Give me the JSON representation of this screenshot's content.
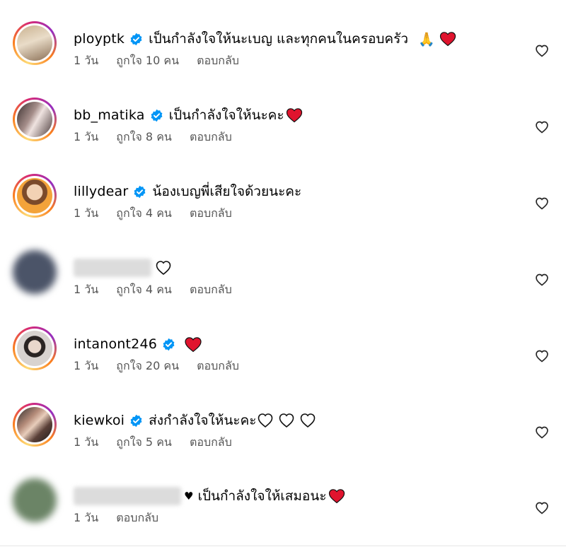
{
  "comments": [
    {
      "username": "ployptk",
      "verified": true,
      "text": "เป็นกำลังใจให้นะเบญ และทุกคนในครอบครัว",
      "emoji": "🙏",
      "time": "1 วัน",
      "likes": "ถูกใจ 10 คน",
      "reply": "ตอบกลับ"
    },
    {
      "username": "bb_matika",
      "verified": true,
      "text": "เป็นกำลังใจให้นะคะ",
      "time": "1 วัน",
      "likes": "ถูกใจ 8 คน",
      "reply": "ตอบกลับ"
    },
    {
      "username": "lillydear",
      "verified": true,
      "text": "น้องเบญพี่เสียใจด้วยนะคะ",
      "time": "1 วัน",
      "likes": "ถูกใจ 4 คน",
      "reply": "ตอบกลับ"
    },
    {
      "username": "",
      "verified": false,
      "text": "",
      "time": "1 วัน",
      "likes": "ถูกใจ 4 คน",
      "reply": "ตอบกลับ"
    },
    {
      "username": "intanont246",
      "verified": true,
      "text": "",
      "time": "1 วัน",
      "likes": "ถูกใจ 20 คน",
      "reply": "ตอบกลับ"
    },
    {
      "username": "kiewkoi",
      "verified": true,
      "text": "ส่งกำลังใจให้นะคะ",
      "time": "1 วัน",
      "likes": "ถูกใจ 5 คน",
      "reply": "ตอบกลับ"
    },
    {
      "username": "",
      "verified": false,
      "text": "เป็นกำลังใจให้เสมอนะ",
      "prefix": "♥",
      "time": "1 วัน",
      "reply": "ตอบกลับ"
    }
  ],
  "colors": {
    "verified": "#0095f6",
    "heart_red": "#e0142e",
    "meta_text": "#555555"
  },
  "icons": {
    "like": "heart-outline-icon",
    "verified": "verified-badge-icon"
  }
}
